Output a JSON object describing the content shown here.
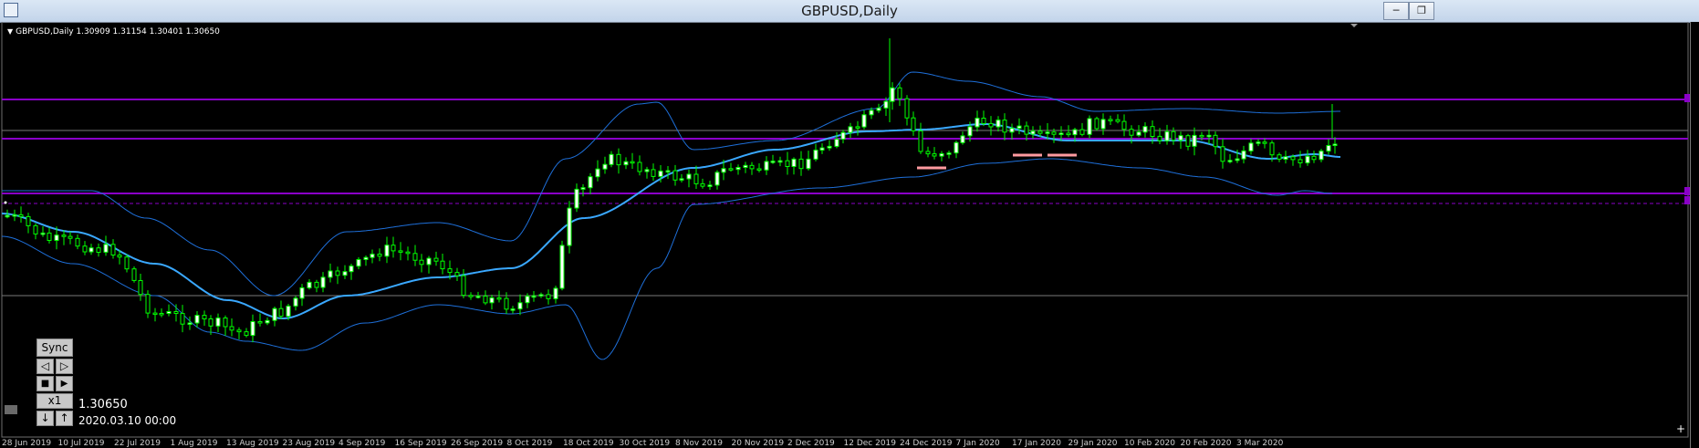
{
  "window": {
    "title": "GBPUSD,Daily",
    "minimize_label": "─",
    "restore_label": "❐"
  },
  "symbol_header": "GBPUSD,Daily  1.30909 1.31154 1.30401 1.30650",
  "readout": {
    "price": "1.30650",
    "datetime": "2020.03.10 00:00"
  },
  "panel": {
    "sync_label": "Sync",
    "zoom_label": "x1",
    "prev_icon": "◁",
    "next_icon": "▷",
    "stop_icon": "■",
    "play_icon": "▶",
    "down_icon": "↓",
    "up_icon": "↑"
  },
  "plus_label": "+",
  "date_labels": [
    "28 Jun 2019",
    "10 Jul 2019",
    "22 Jul 2019",
    "1 Aug 2019",
    "13 Aug 2019",
    "23 Aug 2019",
    "4 Sep 2019",
    "16 Sep 2019",
    "26 Sep 2019",
    "8 Oct 2019",
    "18 Oct 2019",
    "30 Oct 2019",
    "8 Nov 2019",
    "20 Nov 2019",
    "2 Dec 2019",
    "12 Dec 2019",
    "24 Dec 2019",
    "7 Jan 2020",
    "17 Jan 2020",
    "29 Jan 2020",
    "10 Feb 2020",
    "20 Feb 2020",
    "3 Mar 2020"
  ],
  "chart_data": {
    "type": "candlestick",
    "symbol": "GBPUSD",
    "timeframe": "Daily",
    "last_ohlc": {
      "open": 1.30909,
      "high": 1.31154,
      "low": 1.30401,
      "close": 1.3065
    },
    "indicators": [
      "Bollinger Bands",
      "Moving Average"
    ],
    "colors": {
      "bull_body": "#ffffff",
      "bull_wick": "#00ff00",
      "bear_body": "#000000",
      "bear_wick": "#00ff00",
      "bands": "#1e6fd9",
      "ma": "#3aa8ff",
      "levels": "#8a00c8",
      "marker": "#ff9aa0"
    }
  }
}
